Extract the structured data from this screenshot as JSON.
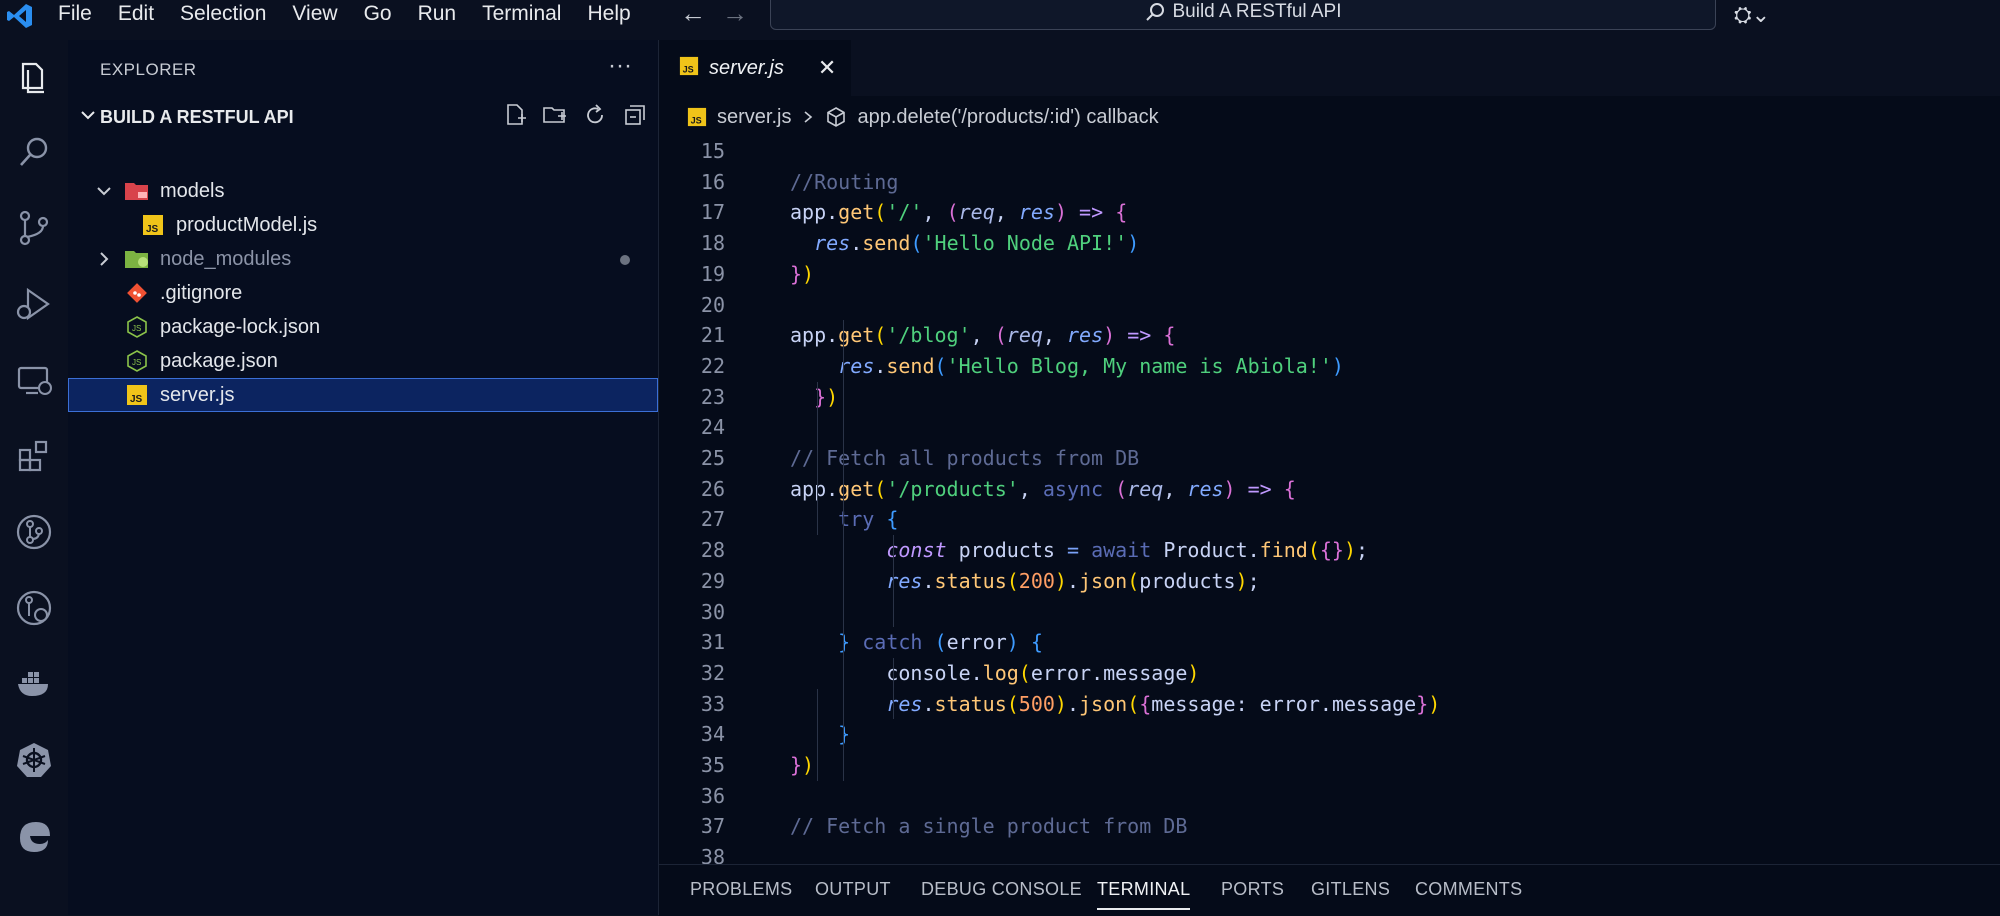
{
  "menu": [
    "File",
    "Edit",
    "Selection",
    "View",
    "Go",
    "Run",
    "Terminal",
    "Help"
  ],
  "search": {
    "text": "Build A RESTful API"
  },
  "activity_icons": [
    "explorer-icon",
    "search-icon",
    "source-control-icon",
    "run-debug-icon",
    "remote-explorer-icon",
    "extensions-icon",
    "gitlens-icon",
    "git-graph-icon",
    "docker-icon",
    "kubernetes-icon",
    "edge-icon"
  ],
  "sidebar": {
    "title": "EXPLORER",
    "project": "BUILD A RESTFUL API",
    "items": [
      {
        "label": "models",
        "type": "folder-open",
        "indent": 1
      },
      {
        "label": "productModel.js",
        "type": "js",
        "indent": 2
      },
      {
        "label": "node_modules",
        "type": "folder-closed",
        "indent": 1
      },
      {
        "label": ".gitignore",
        "type": "git",
        "indent": 1
      },
      {
        "label": "package-lock.json",
        "type": "json",
        "indent": 1
      },
      {
        "label": "package.json",
        "type": "json",
        "indent": 1
      },
      {
        "label": "server.js",
        "type": "js",
        "indent": 1
      }
    ]
  },
  "editor": {
    "tab": "server.js",
    "breadcrumb": {
      "file": "server.js",
      "symbol": "app.delete('/products/:id') callback"
    },
    "lines": [
      {
        "n": "15",
        "html": ""
      },
      {
        "n": "16",
        "html": "<span class='c-com'>//Routing</span>"
      },
      {
        "n": "17",
        "html": "<span class='c-obj'>app</span>.<span class='c-fn'>get</span><span class='c-br1'>(</span><span class='c-str'>'/'</span>, <span class='c-br2'>(</span><span class='c-par'>req</span>, <span class='c-var'>res</span><span class='c-br2'>)</span> <span class='c-const'>=&gt;</span> <span class='c-br2'>{</span>"
      },
      {
        "n": "18",
        "html": "  <span class='c-var'>res</span>.<span class='c-fn'>send</span><span class='c-br3'>(</span><span class='c-str'>'Hello Node API!'</span><span class='c-br3'>)</span>"
      },
      {
        "n": "19",
        "html": "<span class='c-br2'>}</span><span class='c-br1'>)</span>"
      },
      {
        "n": "20",
        "html": ""
      },
      {
        "n": "21",
        "html": "<span class='c-obj'>app</span>.<span class='c-fn'>get</span><span class='c-br1'>(</span><span class='c-str'>'/blog'</span>, <span class='c-br2'>(</span><span class='c-par'>req</span>, <span class='c-var'>res</span><span class='c-br2'>)</span> <span class='c-const'>=&gt;</span> <span class='c-br2'>{</span>"
      },
      {
        "n": "22",
        "html": "    <span class='c-var'>res</span>.<span class='c-fn'>send</span><span class='c-br3'>(</span><span class='c-str'>'Hello Blog, My name is Abiola!'</span><span class='c-br3'>)</span>"
      },
      {
        "n": "23",
        "html": "  <span class='c-br2'>}</span><span class='c-br1'>)</span>"
      },
      {
        "n": "24",
        "html": ""
      },
      {
        "n": "25",
        "html": "<span class='c-com'>// Fetch all products from DB</span>"
      },
      {
        "n": "26",
        "html": "<span class='c-obj'>app</span>.<span class='c-fn'>get</span><span class='c-br1'>(</span><span class='c-str'>'/products'</span>, <span class='c-mut'>async</span> <span class='c-br2'>(</span><span class='c-par'>req</span>, <span class='c-var'>res</span><span class='c-br2'>)</span> <span class='c-const'>=&gt;</span> <span class='c-br2'>{</span>"
      },
      {
        "n": "27",
        "html": "    <span class='c-mut'>try</span> <span class='c-br3'>{</span>"
      },
      {
        "n": "28",
        "html": "        <span class='c-const'>const</span> <span class='c-obj'>products</span> <span class='c-kw'>=</span> <span class='c-mut'>await</span> <span class='c-obj'>Product</span>.<span class='c-fn'>find</span><span class='c-br1'>(</span><span class='c-br2'>{}</span><span class='c-br1'>)</span>;"
      },
      {
        "n": "29",
        "html": "        <span class='c-var'>res</span>.<span class='c-fn'>status</span><span class='c-br1'>(</span><span class='c-num'>200</span><span class='c-br1'>)</span>.<span class='c-fn'>json</span><span class='c-br1'>(</span><span class='c-obj'>products</span><span class='c-br1'>)</span>;"
      },
      {
        "n": "30",
        "html": ""
      },
      {
        "n": "31",
        "html": "    <span class='c-br3'>}</span> <span class='c-mut'>catch</span> <span class='c-br3'>(</span><span class='c-obj'>error</span><span class='c-br3'>)</span> <span class='c-br3'>{</span>"
      },
      {
        "n": "32",
        "html": "        <span class='c-obj'>console</span>.<span class='c-fn'>log</span><span class='c-br1'>(</span><span class='c-obj'>error</span>.<span class='c-obj'>message</span><span class='c-br1'>)</span>"
      },
      {
        "n": "33",
        "html": "        <span class='c-var'>res</span>.<span class='c-fn'>status</span><span class='c-br1'>(</span><span class='c-num'>500</span><span class='c-br1'>)</span>.<span class='c-fn'>json</span><span class='c-br1'>(</span><span class='c-br2'>{</span><span class='c-obj'>message</span>: <span class='c-obj'>error</span>.<span class='c-obj'>message</span><span class='c-br2'>}</span><span class='c-br1'>)</span>"
      },
      {
        "n": "34",
        "html": "    <span class='c-br3'>}</span>"
      },
      {
        "n": "35",
        "html": "<span class='c-br2'>}</span><span class='c-br1'>)</span>"
      },
      {
        "n": "36",
        "html": ""
      },
      {
        "n": "37",
        "html": "<span class='c-com'>// Fetch a single product from DB</span>"
      },
      {
        "n": "38",
        "html": ""
      }
    ]
  },
  "panel_tabs": [
    "PROBLEMS",
    "OUTPUT",
    "DEBUG CONSOLE",
    "TERMINAL",
    "PORTS",
    "GITLENS",
    "COMMENTS"
  ],
  "panel_active": "TERMINAL"
}
